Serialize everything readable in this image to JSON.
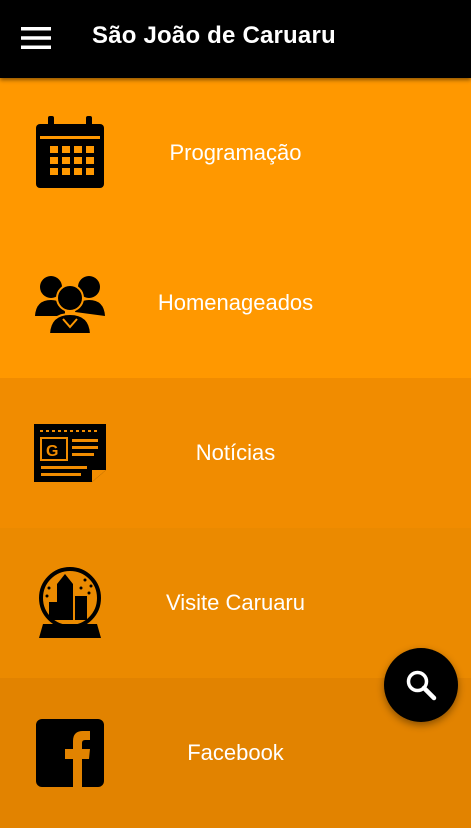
{
  "app": {
    "title": "São João de Caruaru"
  },
  "icons": {
    "menu": "menu-icon",
    "search": "search-icon"
  },
  "items": [
    {
      "label": "Programação",
      "icon": "calendar-icon",
      "bg": "#ff9800"
    },
    {
      "label": "Homenageados",
      "icon": "people-group-icon",
      "bg": "#ff9800"
    },
    {
      "label": "Notícias",
      "icon": "newspaper-icon",
      "bg": "#f18c00"
    },
    {
      "label": "Visite Caruaru",
      "icon": "snow-globe-icon",
      "bg": "#eb8a00"
    },
    {
      "label": "Facebook",
      "icon": "facebook-icon",
      "bg": "#e28300"
    }
  ],
  "colors": {
    "appbar": "#000000",
    "accent": "#ff9800",
    "text": "#ffffff"
  }
}
